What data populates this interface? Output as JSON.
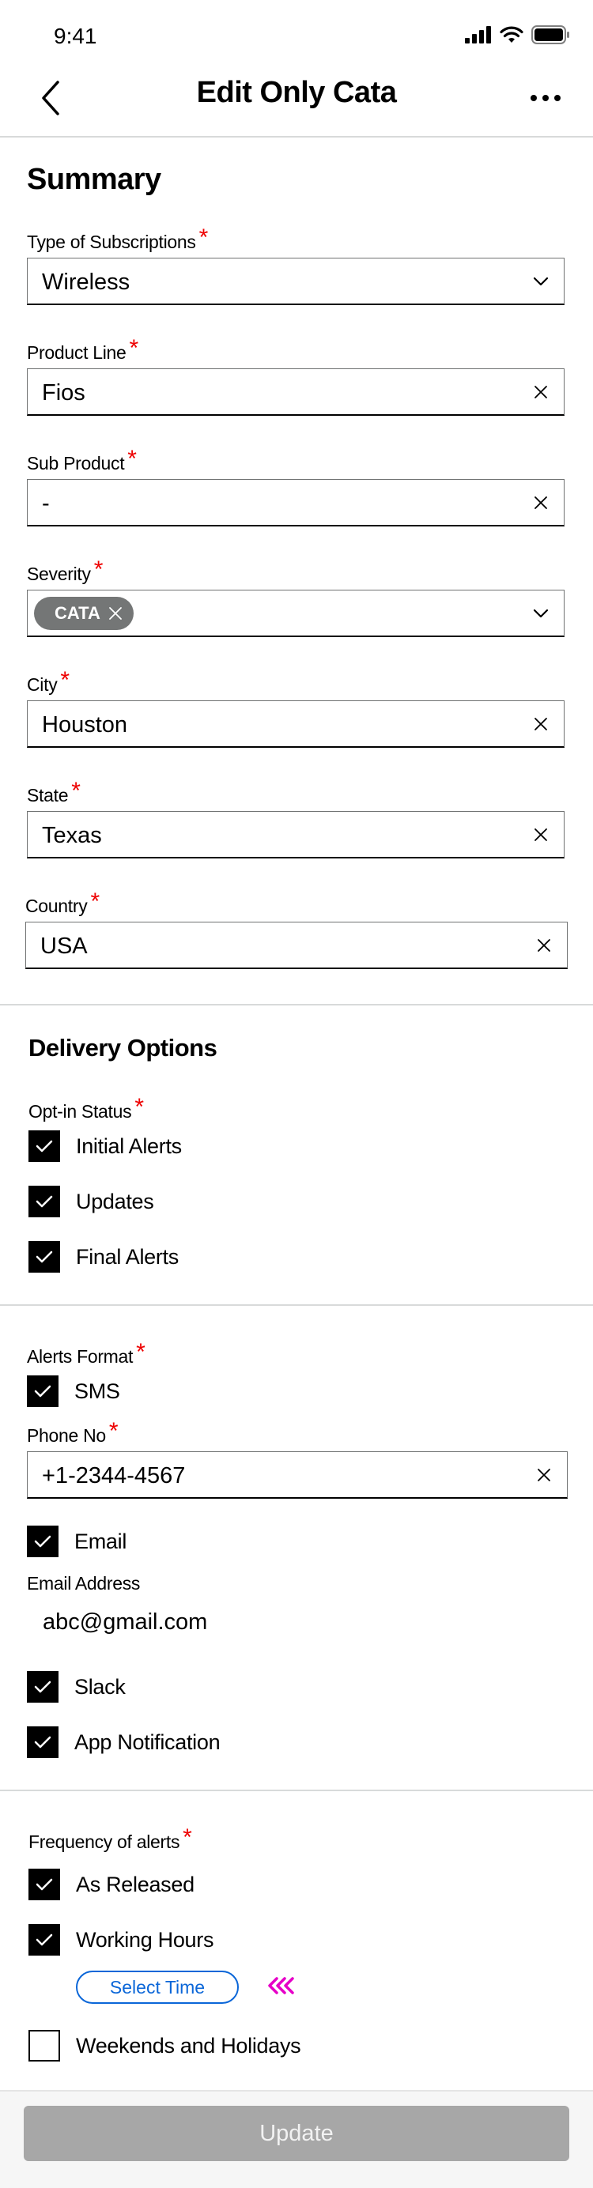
{
  "status_bar": {
    "time": "9:41"
  },
  "nav": {
    "title": "Edit Only Cata"
  },
  "summary": {
    "title": "Summary",
    "fields": {
      "subscription": {
        "label": "Type of Subscriptions",
        "value": "Wireless"
      },
      "product_line": {
        "label": "Product Line",
        "value": "Fios"
      },
      "sub_product": {
        "label": "Sub Product",
        "value": "-"
      },
      "severity": {
        "label": "Severity",
        "chip": "CATA"
      },
      "city": {
        "label": "City",
        "value": "Houston"
      },
      "state": {
        "label": "State",
        "value": "Texas"
      },
      "country": {
        "label": "Country",
        "value": "USA"
      }
    },
    "required_mark": "*"
  },
  "delivery": {
    "title": "Delivery Options",
    "opt_in_label": "Opt-in Status",
    "opt_in": [
      {
        "label": "Initial Alerts",
        "checked": true
      },
      {
        "label": "Updates",
        "checked": true
      },
      {
        "label": "Final Alerts",
        "checked": true
      }
    ]
  },
  "alerts_format": {
    "label": "Alerts Format",
    "sms": {
      "label": "SMS",
      "checked": true
    },
    "phone": {
      "label": "Phone No",
      "value": "+1-2344-4567"
    },
    "email": {
      "label": "Email",
      "checked": true
    },
    "email_address": {
      "label": "Email Address",
      "value": "abc@gmail.com"
    },
    "slack": {
      "label": "Slack",
      "checked": true
    },
    "app_notification": {
      "label": "App Notification",
      "checked": true
    }
  },
  "frequency": {
    "label": "Frequency of alerts",
    "as_released": {
      "label": "As Released",
      "checked": true
    },
    "working_hours": {
      "label": "Working Hours",
      "checked": true
    },
    "select_time": "Select Time",
    "weekends": {
      "label": "Weekends and Holidays",
      "checked": false
    }
  },
  "footer": {
    "update_label": "Update"
  },
  "colors": {
    "required": "#ee0000",
    "link_blue": "#0a66d8",
    "arrow_magenta": "#e600c8",
    "chip_bg": "#747676",
    "disabled_button": "#a7a7a7"
  }
}
